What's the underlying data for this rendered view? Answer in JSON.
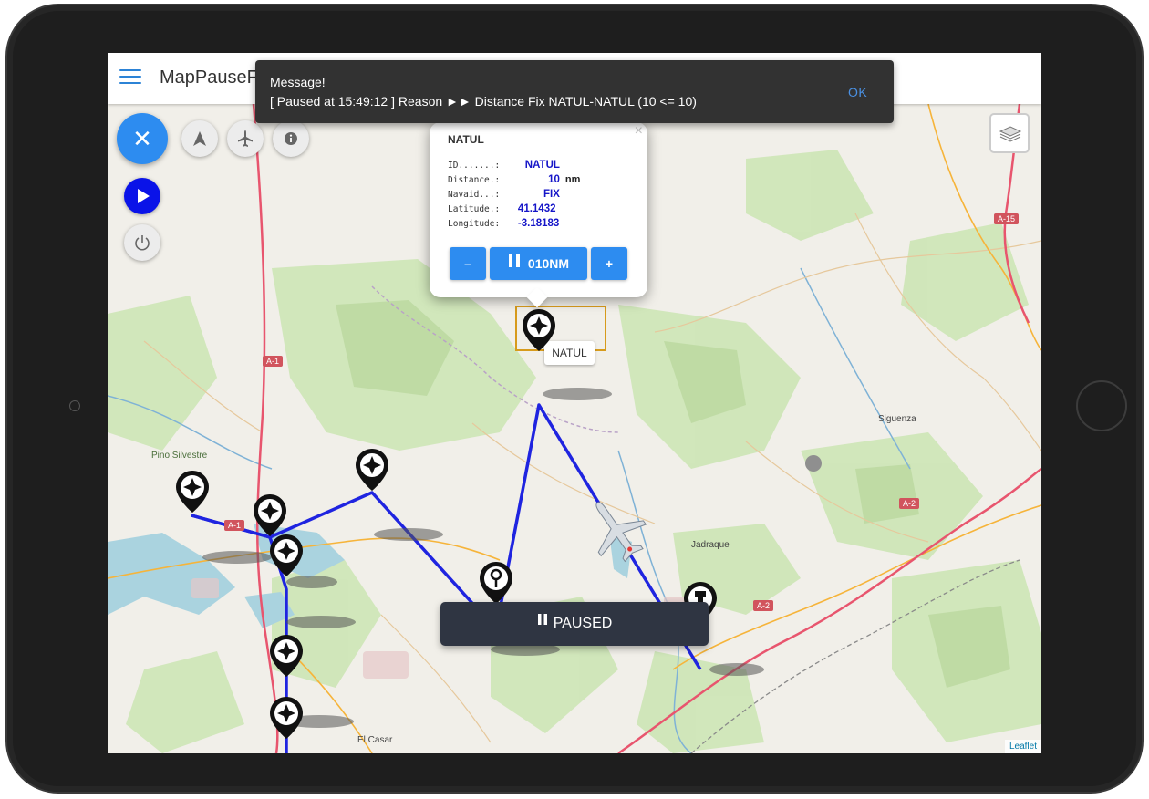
{
  "app": {
    "title": "MapPauseF"
  },
  "snackbar": {
    "title": "Message!",
    "text": "[ Paused at 15:49:12 ] Reason ►► Distance Fix NATUL-NATUL (10 <= 10)",
    "ok_label": "OK"
  },
  "popup": {
    "name": "NATUL",
    "close_glyph": "×",
    "rows": [
      {
        "key": "ID.......:",
        "value": "NATUL",
        "unit": ""
      },
      {
        "key": "Distance.:",
        "value": "10",
        "unit": "nm"
      },
      {
        "key": "Navaid...:",
        "value": "FIX",
        "unit": ""
      },
      {
        "key": "Latitude.:",
        "value": "41.1432",
        "unit": ""
      },
      {
        "key": "Longitude:",
        "value": "-3.18183",
        "unit": ""
      }
    ],
    "minus_label": "–",
    "distance_label": "010NM",
    "plus_label": "+"
  },
  "status": {
    "paused_label": "PAUSED"
  },
  "map": {
    "waypoint_label": "NATUL",
    "attribution": "Leaflet",
    "place_labels": {
      "siguenza": "Siguenza",
      "jadraque": "Jadraque",
      "pino": "Pino Silvestre",
      "el_casar": "El Casar"
    },
    "roads": {
      "a1": "A-1",
      "a1b": "A-1",
      "a2": "A-2",
      "a2b": "A-2",
      "a15": "A-15"
    }
  },
  "colors": {
    "route": "#1f24e0",
    "accent": "#2d8cf0",
    "play": "#0a13e8",
    "snackbar_bg": "#323232",
    "paused_bg": "#2f3542",
    "highlight": "#d79b1c"
  },
  "icons": {
    "menu": "hamburger-icon",
    "close": "close-icon",
    "navigate": "navigation-arrow-icon",
    "airplane": "airplane-icon",
    "info": "info-icon",
    "play": "play-icon",
    "power": "power-icon",
    "layers": "layers-icon",
    "pause": "pause-icon"
  }
}
